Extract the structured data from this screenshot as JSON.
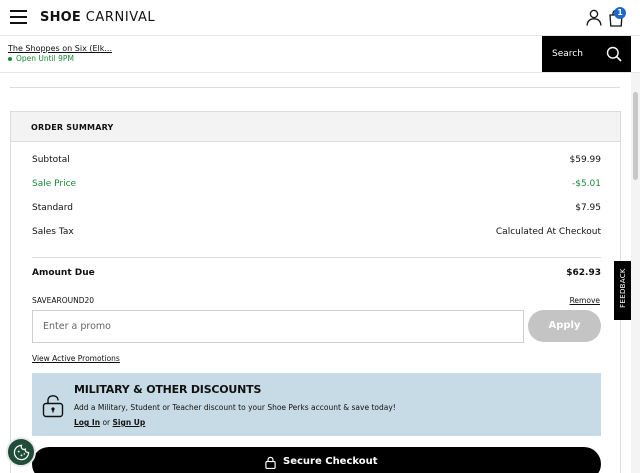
{
  "header": {
    "logo_bold": "SHOE",
    "logo_light": "CARNIVAL",
    "cart_count": "1"
  },
  "store": {
    "name": "The Shoppes on Six (Elk...",
    "status": "Open Until 9PM"
  },
  "search": {
    "label": "Search"
  },
  "order_summary": {
    "title": "ORDER SUMMARY",
    "rows": [
      {
        "label": "Subtotal",
        "value": "$59.99"
      },
      {
        "label": "Sale Price",
        "value": "-$5.01"
      },
      {
        "label": "Standard",
        "value": "$7.95"
      },
      {
        "label": "Sales Tax",
        "value": "Calculated At Checkout"
      }
    ],
    "amount_due": {
      "label": "Amount Due",
      "value": "$62.93"
    },
    "applied_promo": "SAVEAROUND20",
    "remove_label": "Remove",
    "promo_input": {
      "placeholder": "Enter a promo",
      "value": ""
    },
    "apply_label": "Apply",
    "view_promotions": "View Active Promotions"
  },
  "military": {
    "title": "MILITARY & OTHER DISCOUNTS",
    "description": "Add a Military, Student or Teacher discount to your Shoe Perks account & save today!",
    "login_label": "Log In",
    "or_text": "or",
    "signup_label": "Sign Up"
  },
  "checkout": {
    "label": "Secure Checkout"
  },
  "feedback": {
    "label": "FEEDBACK"
  },
  "colors": {
    "accent_black": "#000000",
    "sale_green": "#1a8a3a",
    "discount_panel_blue": "#c7dbe6",
    "badge_blue": "#1e66d0",
    "apply_disabled_gray": "#c4c4c4"
  }
}
